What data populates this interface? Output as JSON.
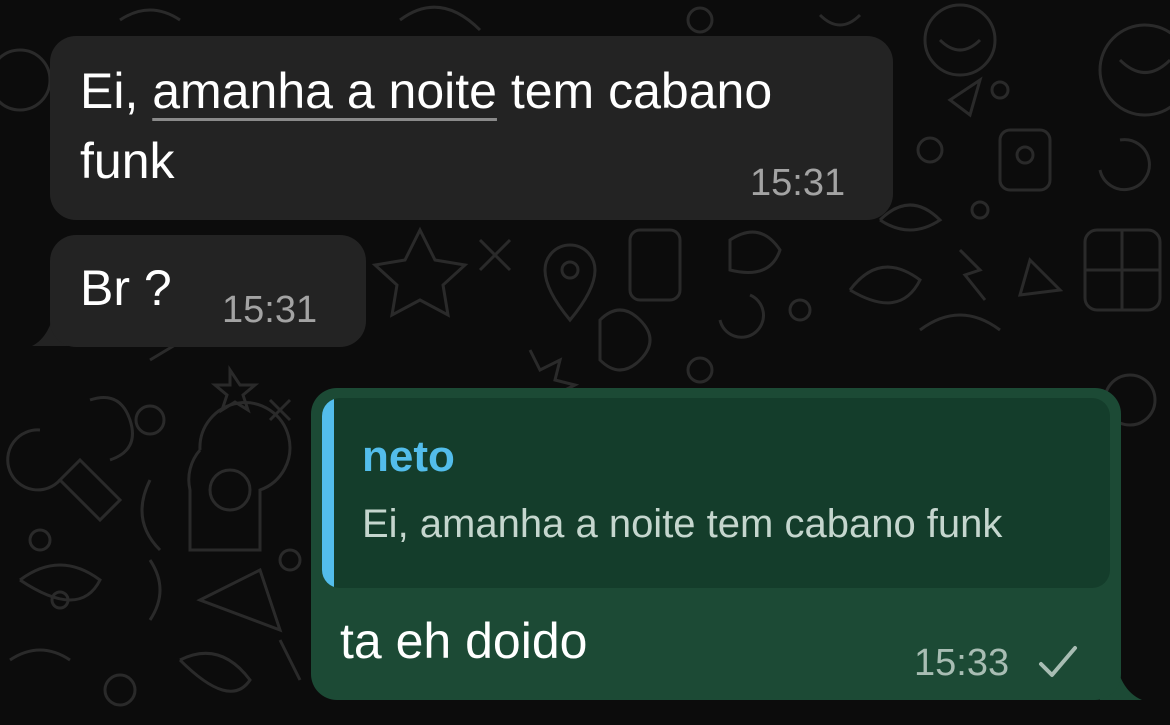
{
  "messages": [
    {
      "direction": "incoming",
      "text_before": "Ei, ",
      "text_link": "amanha a noite",
      "text_after": " tem cabano",
      "text_line2": "funk",
      "time": "15:31"
    },
    {
      "direction": "incoming",
      "text": "Br ?",
      "time": "15:31"
    },
    {
      "direction": "outgoing",
      "quote": {
        "author": "neto",
        "text": "Ei, amanha a noite tem cabano funk"
      },
      "text": "ta eh doido",
      "time": "15:33",
      "status": "sent-check-icon"
    }
  ],
  "colors": {
    "incoming_bubble": "#232323",
    "outgoing_bubble": "#1c4a35",
    "quote_accent": "#53bdeb",
    "background": "#0c0c0c"
  }
}
